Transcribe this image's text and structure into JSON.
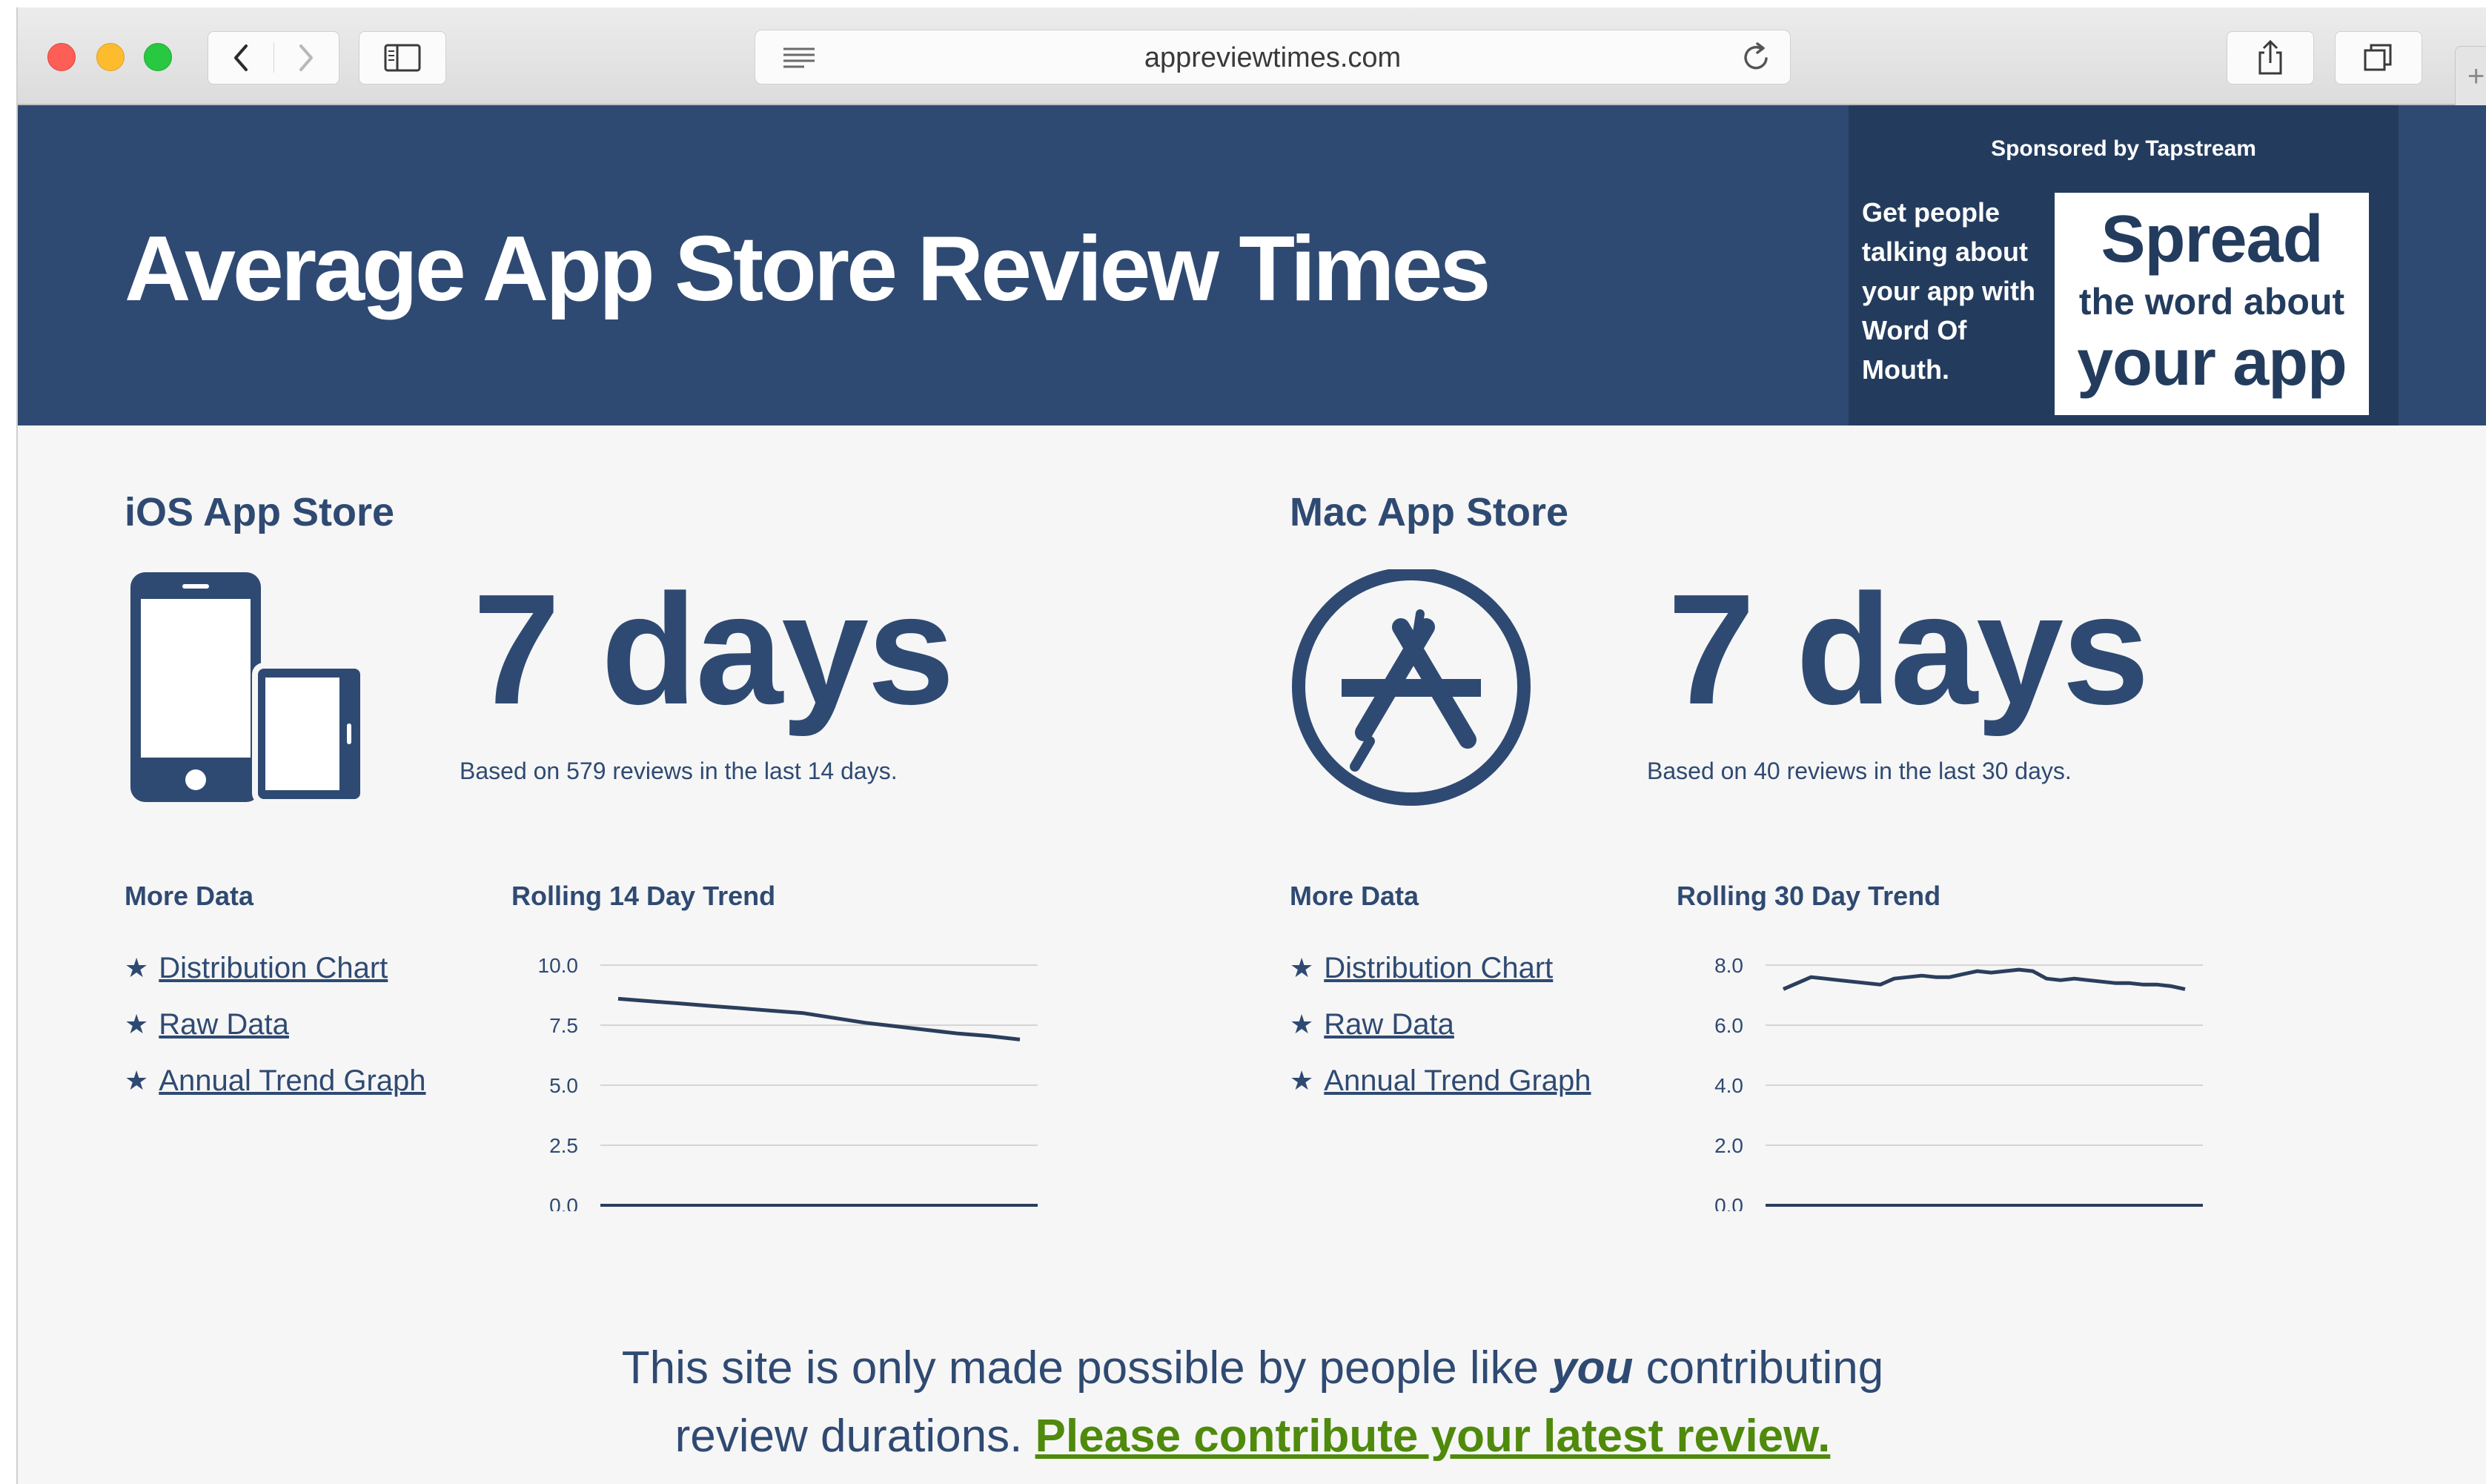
{
  "browser": {
    "url": "appreviewtimes.com",
    "new_tab_glyph": "+"
  },
  "header": {
    "title": "Average App Store Review Times",
    "ad": {
      "sponsor_prefix": "Sponsored by ",
      "sponsor_brand": "Tapstream",
      "copy_lines": [
        "Get people",
        "talking about",
        "your app with",
        "Word Of",
        "Mouth."
      ],
      "box_line1": "Spread",
      "box_line2": "the word about",
      "box_line3": "your app"
    }
  },
  "ios": {
    "title": "iOS App Store",
    "days": "7 days",
    "based_prefix": "Based on ",
    "reviews_link": "579 reviews",
    "based_suffix": " in the last 14 days.",
    "more_data_title": "More Data",
    "links": [
      "Distribution Chart",
      "Raw Data",
      "Annual Trend Graph"
    ],
    "trend_title": "Rolling 14 Day Trend"
  },
  "mac": {
    "title": "Mac App Store",
    "days": "7 days",
    "based_prefix": "Based on ",
    "reviews_link": "40 reviews",
    "based_suffix": " in the last 30 days.",
    "more_data_title": "More Data",
    "links": [
      "Distribution Chart",
      "Raw Data",
      "Annual Trend Graph"
    ],
    "trend_title": "Rolling 30 Day Trend"
  },
  "footer": {
    "line1_prefix": "This site is only made possible by people like ",
    "line1_emph": "you",
    "line1_suffix": " contributing",
    "line2_prefix": "review durations. ",
    "line2_link": "Please contribute your latest review."
  },
  "colors": {
    "navy": "#2f4a72",
    "ad_bg": "#233c5e",
    "contribute_green": "#4f8a0c"
  },
  "chart_data": [
    {
      "type": "line",
      "title": "Rolling 14 Day Trend",
      "ylim": [
        0,
        10
      ],
      "yticks": [
        "0.0",
        "2.5",
        "5.0",
        "7.5",
        "10.0"
      ],
      "grid": true,
      "series": [
        {
          "values": [
            8.6,
            8.5,
            8.4,
            8.3,
            8.2,
            8.1,
            8.0,
            7.8,
            7.6,
            7.45,
            7.3,
            7.15,
            7.05,
            6.9
          ]
        }
      ]
    },
    {
      "type": "line",
      "title": "Rolling 30 Day Trend",
      "ylim": [
        0,
        8
      ],
      "yticks": [
        "0.0",
        "2.0",
        "4.0",
        "6.0",
        "8.0"
      ],
      "grid": true,
      "series": [
        {
          "values": [
            7.2,
            7.4,
            7.6,
            7.55,
            7.5,
            7.45,
            7.4,
            7.35,
            7.55,
            7.6,
            7.65,
            7.6,
            7.6,
            7.7,
            7.8,
            7.75,
            7.8,
            7.85,
            7.8,
            7.55,
            7.5,
            7.55,
            7.5,
            7.45,
            7.4,
            7.4,
            7.35,
            7.35,
            7.3,
            7.2
          ]
        }
      ]
    }
  ]
}
